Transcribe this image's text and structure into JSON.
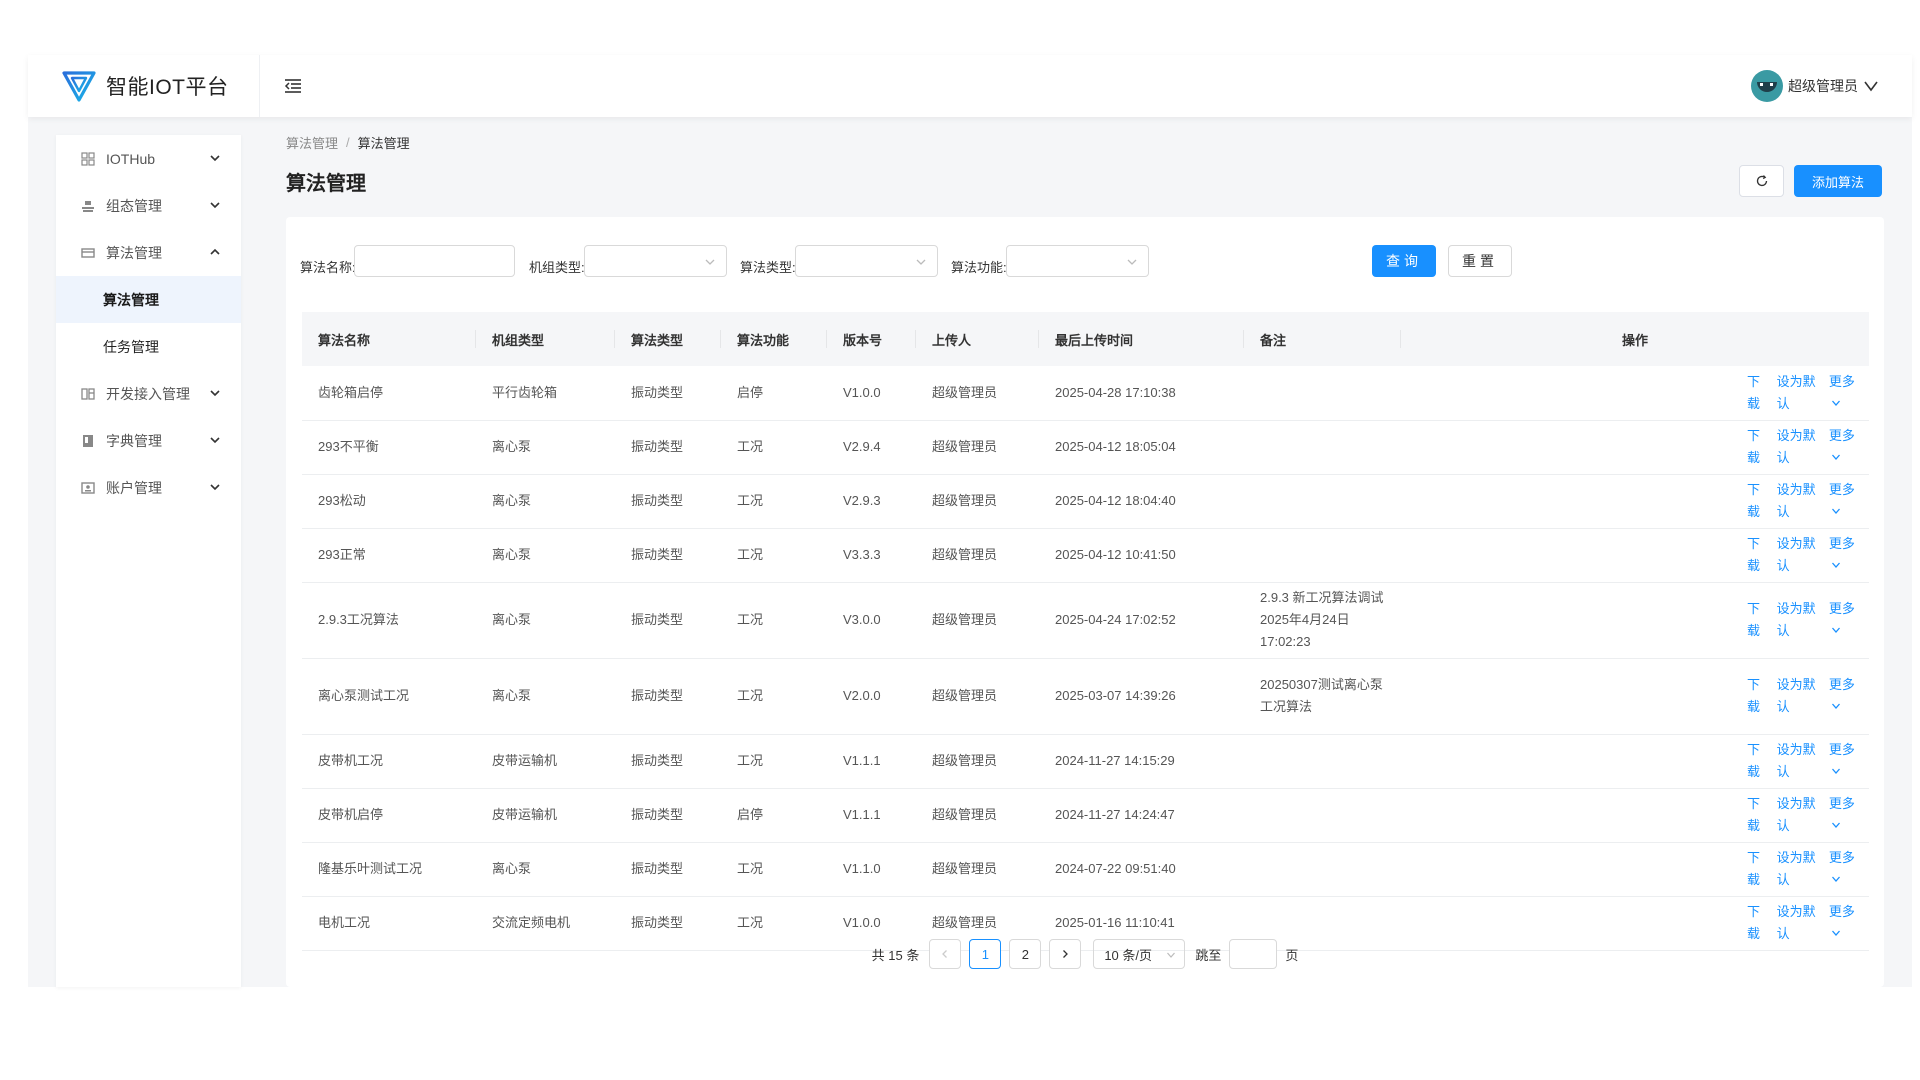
{
  "app": {
    "title": "智能IOT平台",
    "user_name": "超级管理员"
  },
  "sidebar": {
    "items": [
      {
        "label": "IOTHub",
        "icon": "grid-icon",
        "expanded": false
      },
      {
        "label": "组态管理",
        "icon": "layers-icon",
        "expanded": false
      },
      {
        "label": "算法管理",
        "icon": "card-icon",
        "expanded": true
      },
      {
        "label": "开发接入管理",
        "icon": "code-icon",
        "expanded": false
      },
      {
        "label": "字典管理",
        "icon": "book-icon",
        "expanded": false
      },
      {
        "label": "账户管理",
        "icon": "user-card-icon",
        "expanded": false
      }
    ],
    "sub_items": [
      {
        "label": "算法管理",
        "active": true
      },
      {
        "label": "任务管理",
        "active": false
      }
    ]
  },
  "breadcrumb": {
    "parent": "算法管理",
    "separator": "/",
    "current": "算法管理"
  },
  "page": {
    "title": "算法管理",
    "add_button": "添加算法"
  },
  "filters": {
    "name_label": "算法名称:",
    "unit_type_label": "机组类型:",
    "algo_type_label": "算法类型:",
    "algo_func_label": "算法功能:",
    "query_button": "查询",
    "reset_button": "重置"
  },
  "table": {
    "headers": [
      "算法名称",
      "机组类型",
      "算法类型",
      "算法功能",
      "版本号",
      "上传人",
      "最后上传时间",
      "备注",
      "操作"
    ],
    "actions": {
      "download": "下载",
      "set_default": "设为默认",
      "more": "更多"
    },
    "rows": [
      {
        "name": "齿轮箱启停",
        "unit": "平行齿轮箱",
        "type": "振动类型",
        "func": "启停",
        "version": "V1.0.0",
        "uploader": "超级管理员",
        "time": "2025-04-28 17:10:38",
        "note": ""
      },
      {
        "name": "293不平衡",
        "unit": "离心泵",
        "type": "振动类型",
        "func": "工况",
        "version": "V2.9.4",
        "uploader": "超级管理员",
        "time": "2025-04-12 18:05:04",
        "note": ""
      },
      {
        "name": "293松动",
        "unit": "离心泵",
        "type": "振动类型",
        "func": "工况",
        "version": "V2.9.3",
        "uploader": "超级管理员",
        "time": "2025-04-12 18:04:40",
        "note": ""
      },
      {
        "name": "293正常",
        "unit": "离心泵",
        "type": "振动类型",
        "func": "工况",
        "version": "V3.3.3",
        "uploader": "超级管理员",
        "time": "2025-04-12 10:41:50",
        "note": ""
      },
      {
        "name": "2.9.3工况算法",
        "unit": "离心泵",
        "type": "振动类型",
        "func": "工况",
        "version": "V3.0.0",
        "uploader": "超级管理员",
        "time": "2025-04-24 17:02:52",
        "note": "2.9.3 新工况算法调试 2025年4月24日17:02:23"
      },
      {
        "name": "离心泵测试工况",
        "unit": "离心泵",
        "type": "振动类型",
        "func": "工况",
        "version": "V2.0.0",
        "uploader": "超级管理员",
        "time": "2025-03-07 14:39:26",
        "note": "20250307测试离心泵工况算法"
      },
      {
        "name": "皮带机工况",
        "unit": "皮带运输机",
        "type": "振动类型",
        "func": "工况",
        "version": "V1.1.1",
        "uploader": "超级管理员",
        "time": "2024-11-27 14:15:29",
        "note": ""
      },
      {
        "name": "皮带机启停",
        "unit": "皮带运输机",
        "type": "振动类型",
        "func": "启停",
        "version": "V1.1.1",
        "uploader": "超级管理员",
        "time": "2024-11-27 14:24:47",
        "note": ""
      },
      {
        "name": "隆基乐叶测试工况",
        "unit": "离心泵",
        "type": "振动类型",
        "func": "工况",
        "version": "V1.1.0",
        "uploader": "超级管理员",
        "time": "2024-07-22 09:51:40",
        "note": ""
      },
      {
        "name": "电机工况",
        "unit": "交流定频电机",
        "type": "振动类型",
        "func": "工况",
        "version": "V1.0.0",
        "uploader": "超级管理员",
        "time": "2025-01-16 11:10:41",
        "note": ""
      }
    ]
  },
  "pagination": {
    "total": "共 15 条",
    "pages": [
      "1",
      "2"
    ],
    "current_page": "1",
    "page_size": "10 条/页",
    "jump_label": "跳至",
    "page_suffix": "页"
  },
  "colors": {
    "primary": "#1890ff",
    "active_menu_bg": "#eef4fd"
  }
}
